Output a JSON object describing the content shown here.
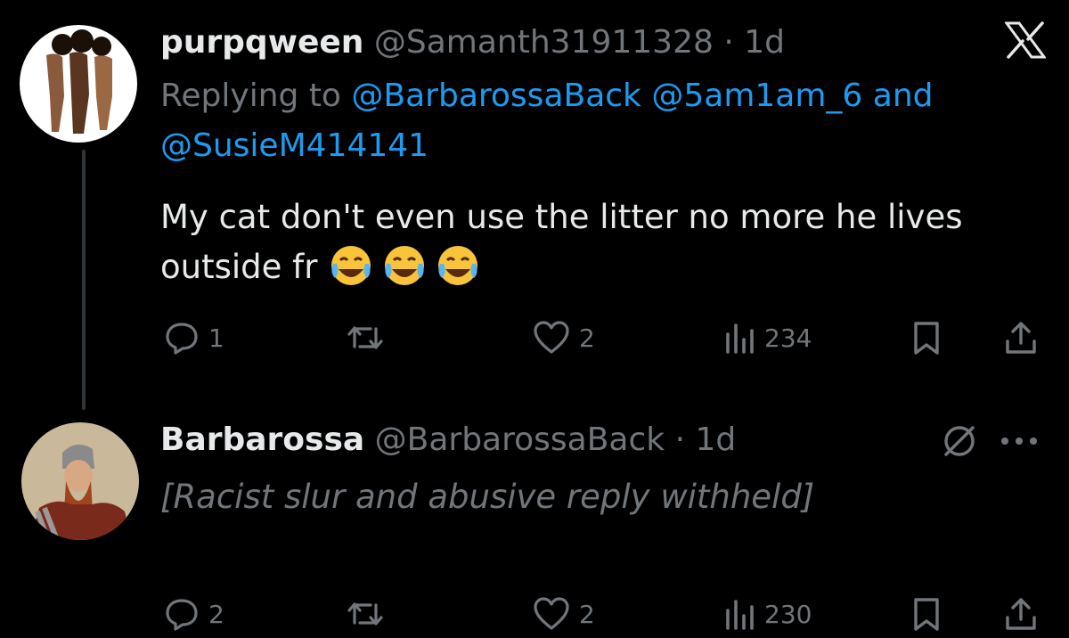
{
  "posts": [
    {
      "display_name": "purpqween",
      "handle": "@Samanth31911328",
      "separator": "·",
      "time": "1d",
      "replying_to": {
        "prefix": "Replying to",
        "mention_1": "@BarbarossaBack",
        "mention_2": "@5am1am_6",
        "conjunction": "and",
        "mention_3": "@SusieM414141"
      },
      "text_line_1": "My cat don't even use the litter no more he lives",
      "text_line_2": "outside fr",
      "emojis": [
        "face-with-tears-of-joy",
        "face-with-tears-of-joy",
        "face-with-tears-of-joy"
      ],
      "actions": {
        "replies": "1",
        "reposts": "",
        "likes": "2",
        "views": "234"
      }
    },
    {
      "display_name": "Barbarossa",
      "handle": "@BarbarossaBack",
      "separator": "·",
      "time": "1d",
      "text_placeholder": "[Racist slur and abusive reply withheld]",
      "actions": {
        "replies": "2",
        "reposts": "",
        "likes": "2",
        "views": "230"
      }
    }
  ],
  "icons": {
    "header": "x-logo-icon",
    "post_2_top": [
      "blocked-icon",
      "more-options-icon"
    ],
    "action_bar": [
      "reply-icon",
      "repost-icon",
      "like-icon",
      "views-icon",
      "bookmark-icon",
      "share-icon"
    ]
  },
  "colors": {
    "background": "#000000",
    "text_primary": "#e7e9ea",
    "text_secondary": "#71767b",
    "mention": "#1d9bf0",
    "thread_line": "#333639"
  }
}
